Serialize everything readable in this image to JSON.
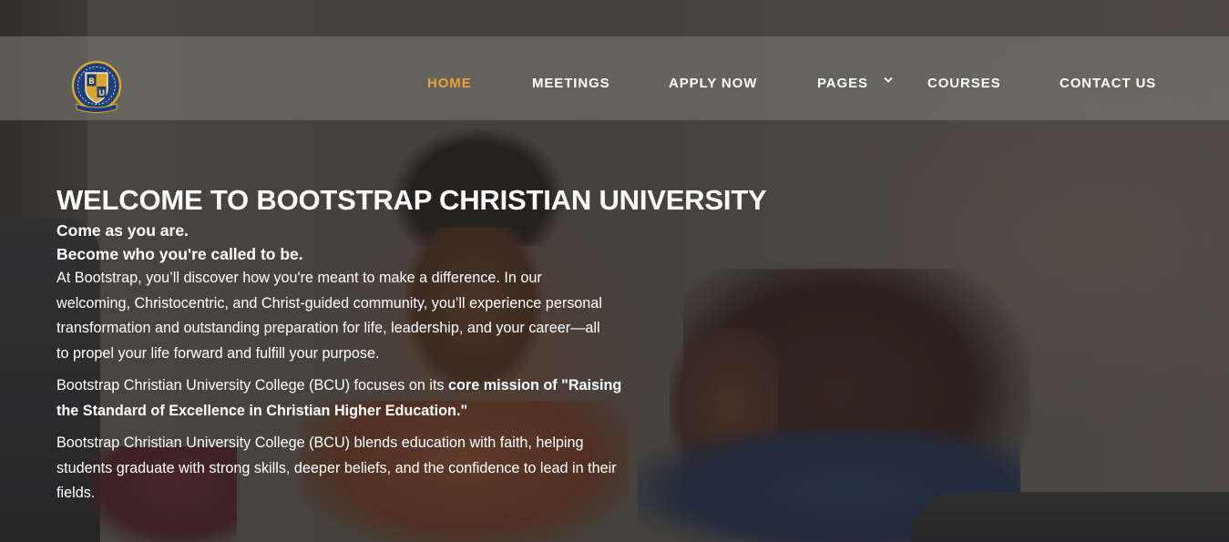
{
  "header": {
    "logo": {
      "label": "logo",
      "colors": {
        "ring": "#1f3f7a",
        "gold": "#d9a72e",
        "shield_blue": "#1c3c78"
      }
    },
    "nav": [
      {
        "label": "HOME",
        "active": true
      },
      {
        "label": "MEETINGS",
        "active": false
      },
      {
        "label": "APPLY NOW",
        "active": false
      },
      {
        "label": "PAGES",
        "active": false,
        "has_dropdown": true,
        "icon": "chevron-down-icon"
      },
      {
        "label": "COURSES",
        "active": false
      },
      {
        "label": "CONTACT US",
        "active": false
      }
    ],
    "colors": {
      "active": "#e8a23a",
      "text": "#ffffff"
    }
  },
  "hero": {
    "title": "WELCOME TO BOOTSTRAP CHRISTIAN UNIVERSITY",
    "tagline_1": "Come as you are.",
    "tagline_2": "Become who you're called to be.",
    "paragraph_1": "At Bootstrap, you’ll discover how you're meant to make a difference. In our welcoming, Christocentric, and Christ-guided community, you’ll experience personal transformation and outstanding preparation for life, leadership, and your career—all to propel your life forward and fulfill your purpose.",
    "paragraph_2_prefix": "Bootstrap Christian University College (BCU) focuses on its ",
    "paragraph_2_bold": "core mission of \"Raising the Standard of Excellence in Christian Higher Education.\"",
    "paragraph_3": "Bootstrap Christian University College (BCU) blends education with faith, helping students graduate with strong skills, deeper beliefs, and the confidence to lead in their fields."
  }
}
